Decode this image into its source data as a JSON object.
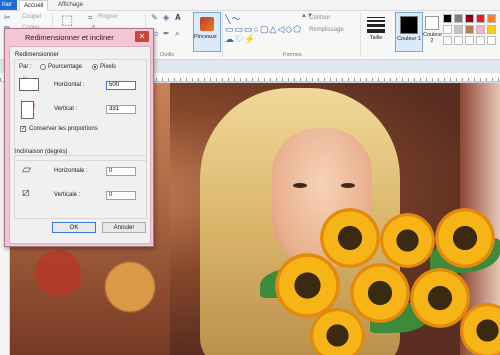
{
  "ribbon": {
    "tab_fichier": "hier",
    "tabs": [
      "Accueil",
      "Affichage"
    ],
    "clipboard": {
      "cut": "Couper",
      "copy": "Copier"
    },
    "image": {
      "crop": "Rogner"
    },
    "group_outils": "Outils",
    "brushes_label": "Pinceaux",
    "group_formes": "Formes",
    "outline": "Contour",
    "fill": "Remplissage",
    "size_label": "Taille",
    "color1_label": "Couleur 1",
    "color2_label": "Couleur 2",
    "palette": [
      "#000000",
      "#7f7f7f",
      "#880015",
      "#ed1c24",
      "#ff7f27",
      "#ffffff",
      "#c3c3c3",
      "#b97a57",
      "#ffaec9",
      "#ffc90e",
      "#ffffff",
      "#ffffff",
      "#ffffff",
      "#ffffff",
      "#ffffff"
    ]
  },
  "dialog": {
    "title": "Redimensionner et incliner",
    "resize_section": "Redimensionner",
    "by_label": "Par :",
    "option_percent": "Pourcentage",
    "option_pixels": "Pixels",
    "selected_option": "Pixels",
    "horizontal_label": "Horizontal :",
    "horizontal_value": "500",
    "vertical_label": "Vertical :",
    "vertical_value": "331",
    "keep_ratio_label": "Conserver les proportions",
    "keep_ratio_checked": true,
    "skew_section": "Inclinaison (degrés)",
    "skew_horizontal_label": "Horizontale :",
    "skew_horizontal_value": "0",
    "skew_vertical_label": "Verticale :",
    "skew_vertical_value": "0",
    "ok_label": "OK",
    "cancel_label": "Annuler"
  }
}
